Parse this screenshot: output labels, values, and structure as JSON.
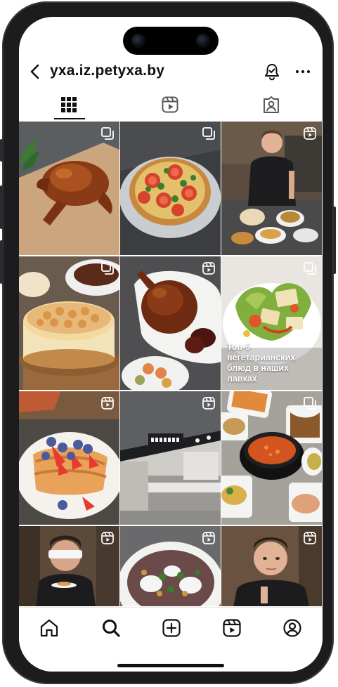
{
  "profile": {
    "username": "yxa.iz.petyxa.by"
  },
  "header": {
    "back_icon": "chevron-left-icon",
    "bell_icon": "bell-check-icon",
    "more_icon": "more-dots-icon"
  },
  "tabs": [
    {
      "name": "grid",
      "icon": "grid-icon",
      "active": true
    },
    {
      "name": "reels",
      "icon": "reels-icon",
      "active": false
    },
    {
      "name": "tagged",
      "icon": "tagged-icon",
      "active": false
    }
  ],
  "posts": [
    {
      "type": "multi",
      "subject": "roast chicken on parchment"
    },
    {
      "type": "multi",
      "subject": "tomato broccoli quiche"
    },
    {
      "type": "reel",
      "subject": "chef with dishes"
    },
    {
      "type": "multi",
      "subject": "meringue cheesecake"
    },
    {
      "type": "reel",
      "subject": "roast duck on platter"
    },
    {
      "type": "multi",
      "subject": "vegetarian salad",
      "caption": "Топ-5 вегетарианских блюд в наших лавках"
    },
    {
      "type": "reel",
      "subject": "french toast with berries"
    },
    {
      "type": "reel",
      "subject": "shop interior Кулинария"
    },
    {
      "type": "multi",
      "subject": "soup and containers"
    },
    {
      "type": "reel",
      "subject": "blindfolded man"
    },
    {
      "type": "reel",
      "subject": "salad with cheese"
    },
    {
      "type": "reel",
      "subject": "man portrait"
    }
  ],
  "bottom_nav": [
    {
      "name": "home",
      "icon": "home-icon"
    },
    {
      "name": "search",
      "icon": "search-icon"
    },
    {
      "name": "create",
      "icon": "plus-square-icon"
    },
    {
      "name": "reels",
      "icon": "reels-icon"
    },
    {
      "name": "profile",
      "icon": "profile-icon"
    }
  ],
  "colors": {
    "text": "#111111",
    "frame": "#1c1c1e",
    "background": "#ffffff"
  }
}
